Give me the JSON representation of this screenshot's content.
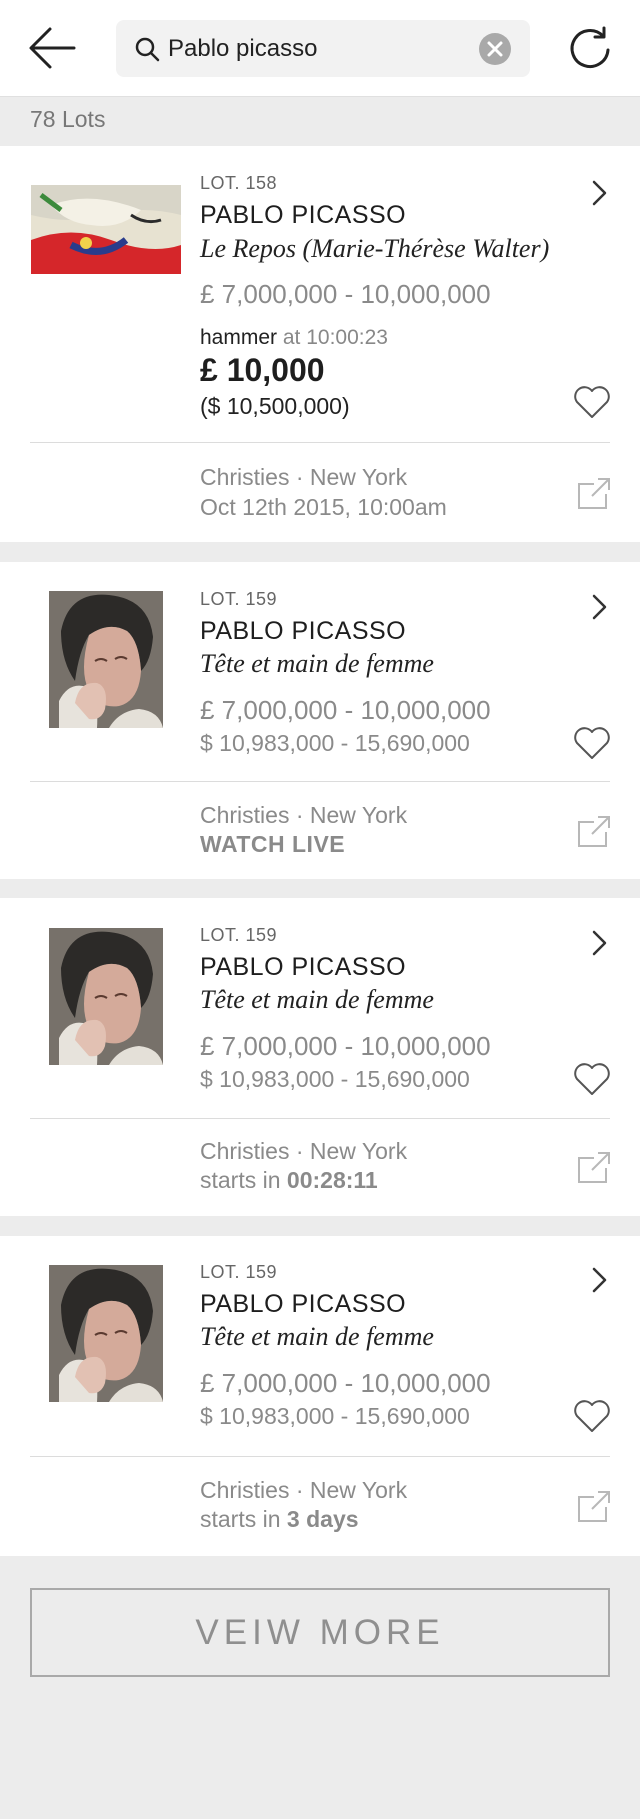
{
  "search": {
    "value": "Pablo picasso"
  },
  "lots_count": "78 Lots",
  "lots": [
    {
      "lot": "LOT. 158",
      "artist": "PABLO PICASSO",
      "title": "Le Repos (Marie-Thérèse Walter)",
      "estimate": "£ 7,000,000 - 10,000,000",
      "hammer_label": "hammer",
      "hammer_time": "at 10:00:23",
      "hammer_price": "£ 10,000",
      "hammer_usd": "($ 10,500,000)",
      "venue": "Christies · New York",
      "date": "Oct 12th 2015, 10:00am"
    },
    {
      "lot": "LOT. 159",
      "artist": "PABLO PICASSO",
      "title": "Tête et main de femme",
      "estimate": "£ 7,000,000 - 10,000,000",
      "estimate_usd": "$ 10,983,000 - 15,690,000",
      "venue": "Christies · New York",
      "status": "WATCH LIVE"
    },
    {
      "lot": "LOT. 159",
      "artist": "PABLO PICASSO",
      "title": "Tête et main de femme",
      "estimate": "£ 7,000,000 - 10,000,000",
      "estimate_usd": "$ 10,983,000 - 15,690,000",
      "venue": "Christies · New York",
      "status_prefix": "starts in",
      "status_value": "00:28:11"
    },
    {
      "lot": "LOT. 159",
      "artist": "PABLO PICASSO",
      "title": "Tête et main de femme",
      "estimate": "£ 7,000,000 - 10,000,000",
      "estimate_usd": "$ 10,983,000 - 15,690,000",
      "venue": "Christies · New York",
      "status_prefix": "starts in",
      "status_value": "3 days"
    }
  ],
  "view_more_label": "VEIW MORE",
  "icons": {
    "back": "arrow-left-icon",
    "search": "search-icon",
    "clear": "close-circle-icon",
    "refresh": "refresh-icon",
    "chevron": "chevron-right-icon",
    "favorite": "heart-icon",
    "external": "external-link-icon"
  },
  "colors": {
    "background": "#ececec",
    "card": "#ffffff",
    "muted_text": "#8a8a8a"
  }
}
